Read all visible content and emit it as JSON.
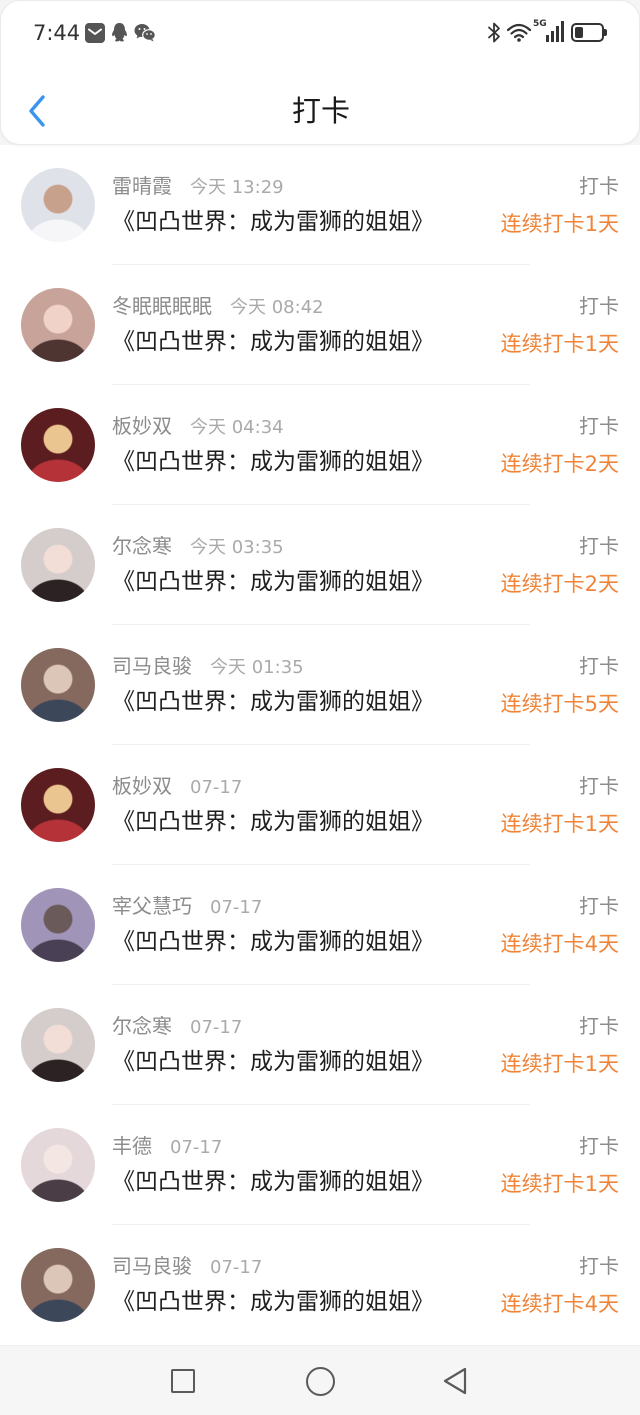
{
  "status_bar": {
    "time": "7:44",
    "network": "5G",
    "battery_level": 0.3,
    "notification_icons": [
      "message-notification-icon",
      "qq-icon",
      "wechat-icon"
    ],
    "system_icons": [
      "bluetooth-icon",
      "wifi-icon",
      "signal-icon",
      "battery-icon"
    ]
  },
  "header": {
    "title": "打卡",
    "back_icon": "chevron-left-icon"
  },
  "colors": {
    "accent": "#3a95ee",
    "streak": "#f0853a",
    "user_name": "#8c8c8c",
    "time": "#aaaaaa",
    "book": "#1f1f1f"
  },
  "checkins": [
    {
      "name": "雷晴霞",
      "time": "今天 13:29",
      "book": "《凹凸世界：成为雷狮的姐姐》",
      "action": "打卡",
      "streak": "连续打卡1天",
      "avatar": {
        "bg": "#dfe3e9",
        "head": "#c7a18b",
        "body": "#f6f6f8"
      }
    },
    {
      "name": "冬眠眠眠眠",
      "time": "今天 08:42",
      "book": "《凹凸世界：成为雷狮的姐姐》",
      "action": "打卡",
      "streak": "连续打卡1天",
      "avatar": {
        "bg": "#c7a39a",
        "head": "#f1d2c8",
        "body": "#4e3531"
      }
    },
    {
      "name": "板妙双",
      "time": "今天 04:34",
      "book": "《凹凸世界：成为雷狮的姐姐》",
      "action": "打卡",
      "streak": "连续打卡2天",
      "avatar": {
        "bg": "#5b1d20",
        "head": "#ebc58f",
        "body": "#b53238"
      }
    },
    {
      "name": "尔念寒",
      "time": "今天 03:35",
      "book": "《凹凸世界：成为雷狮的姐姐》",
      "action": "打卡",
      "streak": "连续打卡2天",
      "avatar": {
        "bg": "#d4cdcb",
        "head": "#f3ddd7",
        "body": "#2c2224"
      }
    },
    {
      "name": "司马良骏",
      "time": "今天 01:35",
      "book": "《凹凸世界：成为雷狮的姐姐》",
      "action": "打卡",
      "streak": "连续打卡5天",
      "avatar": {
        "bg": "#86695e",
        "head": "#dcc6b8",
        "body": "#3c475a"
      }
    },
    {
      "name": "板妙双",
      "time": "07-17",
      "book": "《凹凸世界：成为雷狮的姐姐》",
      "action": "打卡",
      "streak": "连续打卡1天",
      "avatar": {
        "bg": "#5b1d20",
        "head": "#ebc58f",
        "body": "#b53238"
      }
    },
    {
      "name": "宰父慧巧",
      "time": "07-17",
      "book": "《凹凸世界：成为雷狮的姐姐》",
      "action": "打卡",
      "streak": "连续打卡4天",
      "avatar": {
        "bg": "#a095b8",
        "head": "#6b5a5a",
        "body": "#4a4055"
      }
    },
    {
      "name": "尔念寒",
      "time": "07-17",
      "book": "《凹凸世界：成为雷狮的姐姐》",
      "action": "打卡",
      "streak": "连续打卡1天",
      "avatar": {
        "bg": "#d4cdcb",
        "head": "#f3ddd7",
        "body": "#2c2224"
      }
    },
    {
      "name": "丰德",
      "time": "07-17",
      "book": "《凹凸世界：成为雷狮的姐姐》",
      "action": "打卡",
      "streak": "连续打卡1天",
      "avatar": {
        "bg": "#e5d8da",
        "head": "#f4e7e3",
        "body": "#4a3d46"
      }
    },
    {
      "name": "司马良骏",
      "time": "07-17",
      "book": "《凹凸世界：成为雷狮的姐姐》",
      "action": "打卡",
      "streak": "连续打卡4天",
      "avatar": {
        "bg": "#86695e",
        "head": "#dcc6b8",
        "body": "#3c475a"
      }
    }
  ],
  "nav_bar": {
    "icons": [
      "recents-square-icon",
      "home-circle-icon",
      "back-triangle-icon"
    ]
  }
}
